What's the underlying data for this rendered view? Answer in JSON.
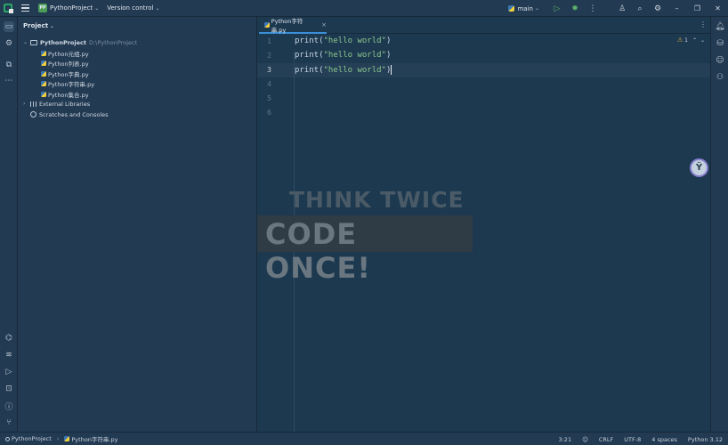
{
  "titlebar": {
    "project_badge": "PP",
    "project_name": "PythonProject",
    "version_control": "Version control",
    "branch": "main"
  },
  "project_panel": {
    "header": "Project",
    "root": {
      "name": "PythonProject",
      "path": "D:\\PythonProject"
    },
    "files": [
      "Python元组.py",
      "Python列表.py",
      "Python字典.py",
      "Python字符串.py",
      "Python集合.py"
    ],
    "external_libraries": "External Libraries",
    "scratches": "Scratches and Consoles"
  },
  "editor": {
    "tab_label": "Python字符串.py",
    "line_numbers": [
      "1",
      "2",
      "3",
      "4",
      "5",
      "6"
    ],
    "code": [
      {
        "fn": "print(",
        "str": "\"hello world\"",
        "end": ")"
      },
      {
        "fn": "print(",
        "str": "\"hello world\"",
        "end": ")"
      },
      {
        "fn": "print(",
        "str": "\"hello world\"",
        "end": ")"
      }
    ],
    "inspection_count": "1"
  },
  "watermark": {
    "line1": "THINK TWICE",
    "line2": "CODE ONCE!"
  },
  "statusbar": {
    "project": "PythonProject",
    "file": "Python字符串.py",
    "position": "3:21",
    "line_ending": "CRLF",
    "encoding": "UTF-8",
    "indent": "4 spaces",
    "interpreter": "Python 3.12"
  },
  "colors": {
    "background": "#1e3a52",
    "accent": "#3b8fd8",
    "string": "#8cc68c",
    "run": "#5cb36a",
    "warning": "#e2b23c"
  },
  "icons": [
    "hamburger-icon",
    "run-icon",
    "debug-icon",
    "more-icon",
    "account-icon",
    "search-icon",
    "settings-icon",
    "folder-icon",
    "notifications-icon",
    "database-icon",
    "copilot-icon",
    "assistant-icon"
  ]
}
